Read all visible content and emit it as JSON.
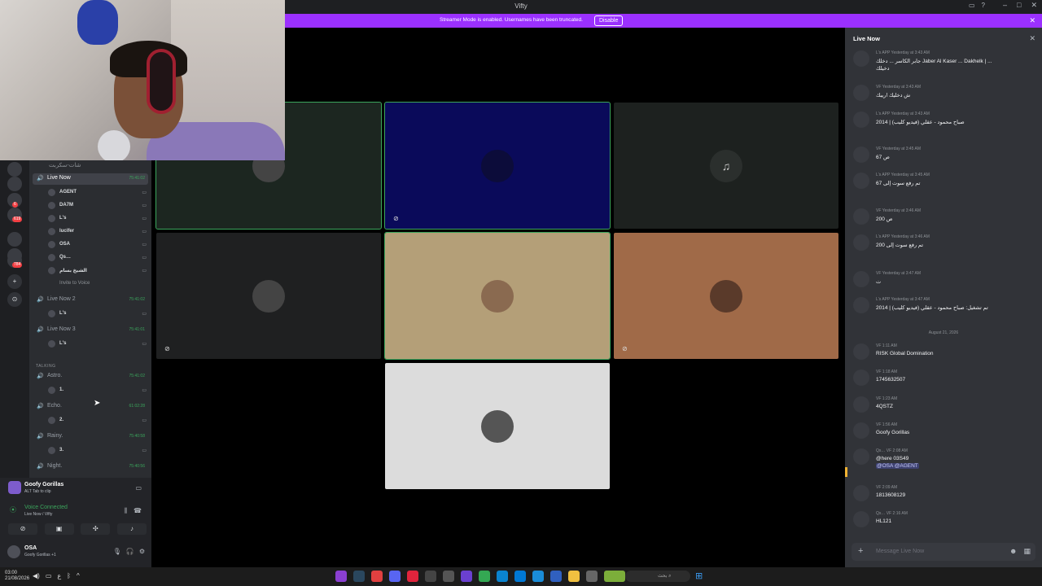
{
  "window": {
    "title": "Vifty"
  },
  "banner": {
    "message": "Streamer Mode is enabled. Usernames have been truncated.",
    "button": "Disable"
  },
  "colors": {
    "accent": "#9b30ff",
    "online": "#3ba55c",
    "blurple": "#5865f2"
  },
  "rail": {
    "items": [
      {
        "icon": "server-icon",
        "badge": ""
      },
      {
        "icon": "server-icon",
        "badge": ""
      },
      {
        "icon": "server-icon",
        "badge": "6"
      },
      {
        "icon": "server-icon",
        "badge": "619"
      },
      {
        "icon": "server-icon",
        "badge": ""
      },
      {
        "icon": "server-icon",
        "badge": ""
      },
      {
        "icon": "server-icon",
        "badge": "784"
      },
      {
        "icon": "add-server-icon",
        "badge": ""
      },
      {
        "icon": "discover-icon",
        "badge": ""
      }
    ]
  },
  "sidebar": {
    "top_channel": "شات-سكربت",
    "voice": [
      {
        "name": "Live Now",
        "time": "75:41:02",
        "active": true,
        "users": [
          "AGENT",
          "DA7M",
          "L's",
          "lucifer",
          "OSA",
          "Qs…",
          "الشيخ بسام"
        ],
        "invite": "Invite to Voice"
      },
      {
        "name": "Live Now 2",
        "time": "75:41:02",
        "users": [
          "L's"
        ]
      },
      {
        "name": "Live Now 3",
        "time": "75:41:01",
        "users": [
          "L's"
        ]
      }
    ],
    "category": "TALKING",
    "talking": [
      {
        "name": "Astro.",
        "time": "75:41:02",
        "user": "1."
      },
      {
        "name": "Echo.",
        "time": "61:02:28",
        "user": "2."
      },
      {
        "name": "Rainy.",
        "time": "75:40:58",
        "user": "3."
      },
      {
        "name": "Night.",
        "time": "75:40:56"
      }
    ]
  },
  "userpanel": {
    "server": "Goofy Gorillas",
    "server_sub": "Tab to clip",
    "server_tag": "ALT",
    "voice_status": "Voice Connected",
    "voice_sub": "Live Now / Vifty",
    "user": "OSA",
    "user_sub": "Goofy Gorillas +1"
  },
  "stage": {
    "tiles": [
      {
        "bg": "#1c2620",
        "speaking": true,
        "mute": ""
      },
      {
        "bg": "#0a0a5a",
        "speaking": true,
        "mute": "muted-icon"
      },
      {
        "bg": "#1d211f",
        "speaking": false,
        "mute": ""
      },
      {
        "bg": "#1f2021",
        "speaking": false,
        "mute": "muted-icon"
      },
      {
        "bg": "#b49f78",
        "speaking": true,
        "mute": ""
      },
      {
        "bg": "#a06a48",
        "speaking": false,
        "mute": "muted-icon"
      },
      {
        "bg": "#dcdcdc",
        "speaking": false,
        "mute": ""
      }
    ]
  },
  "chat": {
    "header": "Live Now",
    "placeholder": "Message Live Now",
    "day_divider": "August 21, 2026",
    "messages": [
      {
        "meta": "L's APP Yesterday at 3:43 AM",
        "text": "جابر الكاسر ... دخلك Jaber Al Kaser ... Dakhelk | ...",
        "text2": "دخيلك"
      },
      {
        "meta": "VF Yesterday at 3:43 AM",
        "text": "ش دخليك اريبك",
        "text2": ""
      },
      {
        "meta": "L's APP Yesterday at 3:43 AM",
        "text": "صباح محمود - عقلي (فيديو كليب) | 2014",
        "text2": ""
      },
      {
        "meta": "VF Yesterday at 3:45 AM",
        "text": "67 ص",
        "text2": ""
      },
      {
        "meta": "L's APP Yesterday at 3:45 AM",
        "text": "تم رفع سوت إلى 67",
        "text2": ""
      },
      {
        "meta": "VF Yesterday at 3:46 AM",
        "text": "200 ص",
        "text2": ""
      },
      {
        "meta": "L's APP Yesterday at 3:46 AM",
        "text": "تم رفع سوت إلى 200",
        "text2": ""
      },
      {
        "meta": "VF Yesterday at 3:47 AM",
        "text": "ت",
        "text2": ""
      },
      {
        "meta": "L's APP Yesterday at 3:47 AM",
        "text": "تم تشغيل: صباح محمود - عقلي (فيديو كليب) | 2014",
        "text2": ""
      },
      {
        "meta": "VF 1:11 AM",
        "text": "RISK Global Domination",
        "text2": ""
      },
      {
        "meta": "VF 1:18 AM",
        "text": "1745632507",
        "text2": ""
      },
      {
        "meta": "VF 1:23 AM",
        "text": "4QSTZ",
        "text2": ""
      },
      {
        "meta": "VF 1:56 AM",
        "text": "Goofy Gorillas",
        "text2": ""
      },
      {
        "meta": "Qs… VF 2:08 AM",
        "text": "@here 03S49",
        "text2": "@OSA @AGENT"
      },
      {
        "meta": "VF 2:09 AM",
        "text": "1813608129",
        "text2": ""
      },
      {
        "meta": "Qs… VF 2:16 AM",
        "text": "HL121",
        "text2": ""
      }
    ]
  },
  "taskbar": {
    "search": "بحث",
    "time": "03:00",
    "date": "21/08/2026"
  }
}
